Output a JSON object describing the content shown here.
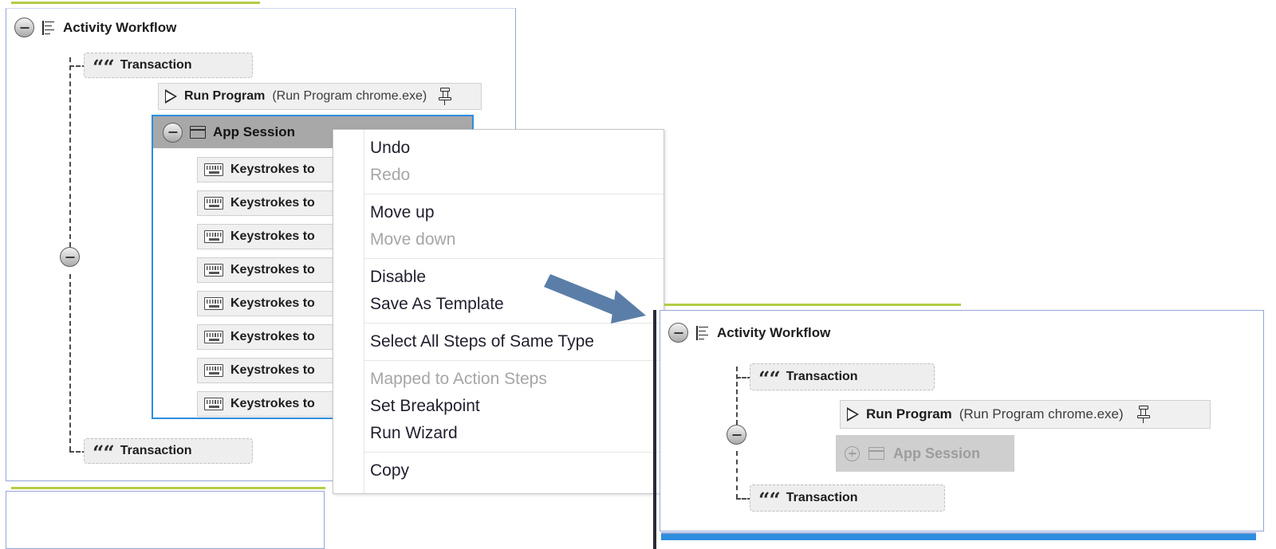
{
  "left_panel": {
    "root": {
      "label": "Activity Workflow",
      "icon": "list-icon",
      "expander": "collapse-circle"
    },
    "transaction_top": {
      "label": "Transaction",
      "icon": "quote-icon"
    },
    "run_program": {
      "name": "Run Program",
      "detail": "(Run Program chrome.exe)",
      "icon": "play-icon",
      "pin": "pin-icon"
    },
    "app_session": {
      "label": "App Session",
      "icon": "window-icon",
      "expander": "collapse-circle"
    },
    "keystroke_steps": [
      {
        "label": "Keystrokes to",
        "icon": "keyboard-icon"
      },
      {
        "label": "Keystrokes to",
        "icon": "keyboard-icon"
      },
      {
        "label": "Keystrokes to",
        "icon": "keyboard-icon"
      },
      {
        "label": "Keystrokes to",
        "icon": "keyboard-icon"
      },
      {
        "label": "Keystrokes to",
        "icon": "keyboard-icon"
      },
      {
        "label": "Keystrokes to",
        "icon": "keyboard-icon"
      },
      {
        "label": "Keystrokes to",
        "icon": "keyboard-icon"
      },
      {
        "label": "Keystrokes to",
        "icon": "keyboard-icon"
      }
    ],
    "transaction_bottom": {
      "label": "Transaction",
      "icon": "quote-icon"
    }
  },
  "context_menu": {
    "groups": [
      [
        {
          "label": "Undo",
          "disabled": false
        },
        {
          "label": "Redo",
          "disabled": true
        }
      ],
      [
        {
          "label": "Move up",
          "disabled": false
        },
        {
          "label": "Move down",
          "disabled": true
        }
      ],
      [
        {
          "label": "Disable",
          "disabled": false
        },
        {
          "label": "Save As Template",
          "disabled": false
        }
      ],
      [
        {
          "label": "Select All Steps of Same Type",
          "disabled": false
        }
      ],
      [
        {
          "label": "Mapped to Action Steps",
          "disabled": true
        },
        {
          "label": "Set Breakpoint",
          "disabled": false
        },
        {
          "label": "Run Wizard",
          "disabled": false
        }
      ],
      [
        {
          "label": "Copy",
          "disabled": false
        }
      ]
    ]
  },
  "right_panel": {
    "root": {
      "label": "Activity Workflow",
      "icon": "list-icon",
      "expander": "collapse-circle"
    },
    "transaction_top": {
      "label": "Transaction",
      "icon": "quote-icon"
    },
    "run_program": {
      "name": "Run Program",
      "detail": "(Run Program chrome.exe)",
      "icon": "play-icon",
      "pin": "pin-icon"
    },
    "app_session": {
      "label": "App Session",
      "icon": "window-icon",
      "expander": "expand-circle",
      "state": "collapsed"
    },
    "transaction_bottom": {
      "label": "Transaction",
      "icon": "quote-icon"
    }
  },
  "colors": {
    "accent_green": "#b4cc43",
    "panel_border": "#93a6d8",
    "selection_blue": "#2e8ddf",
    "arrow": "#5b7ea8",
    "header_grey": "#a8a8a8",
    "disabled_text": "#a6a6a6"
  }
}
